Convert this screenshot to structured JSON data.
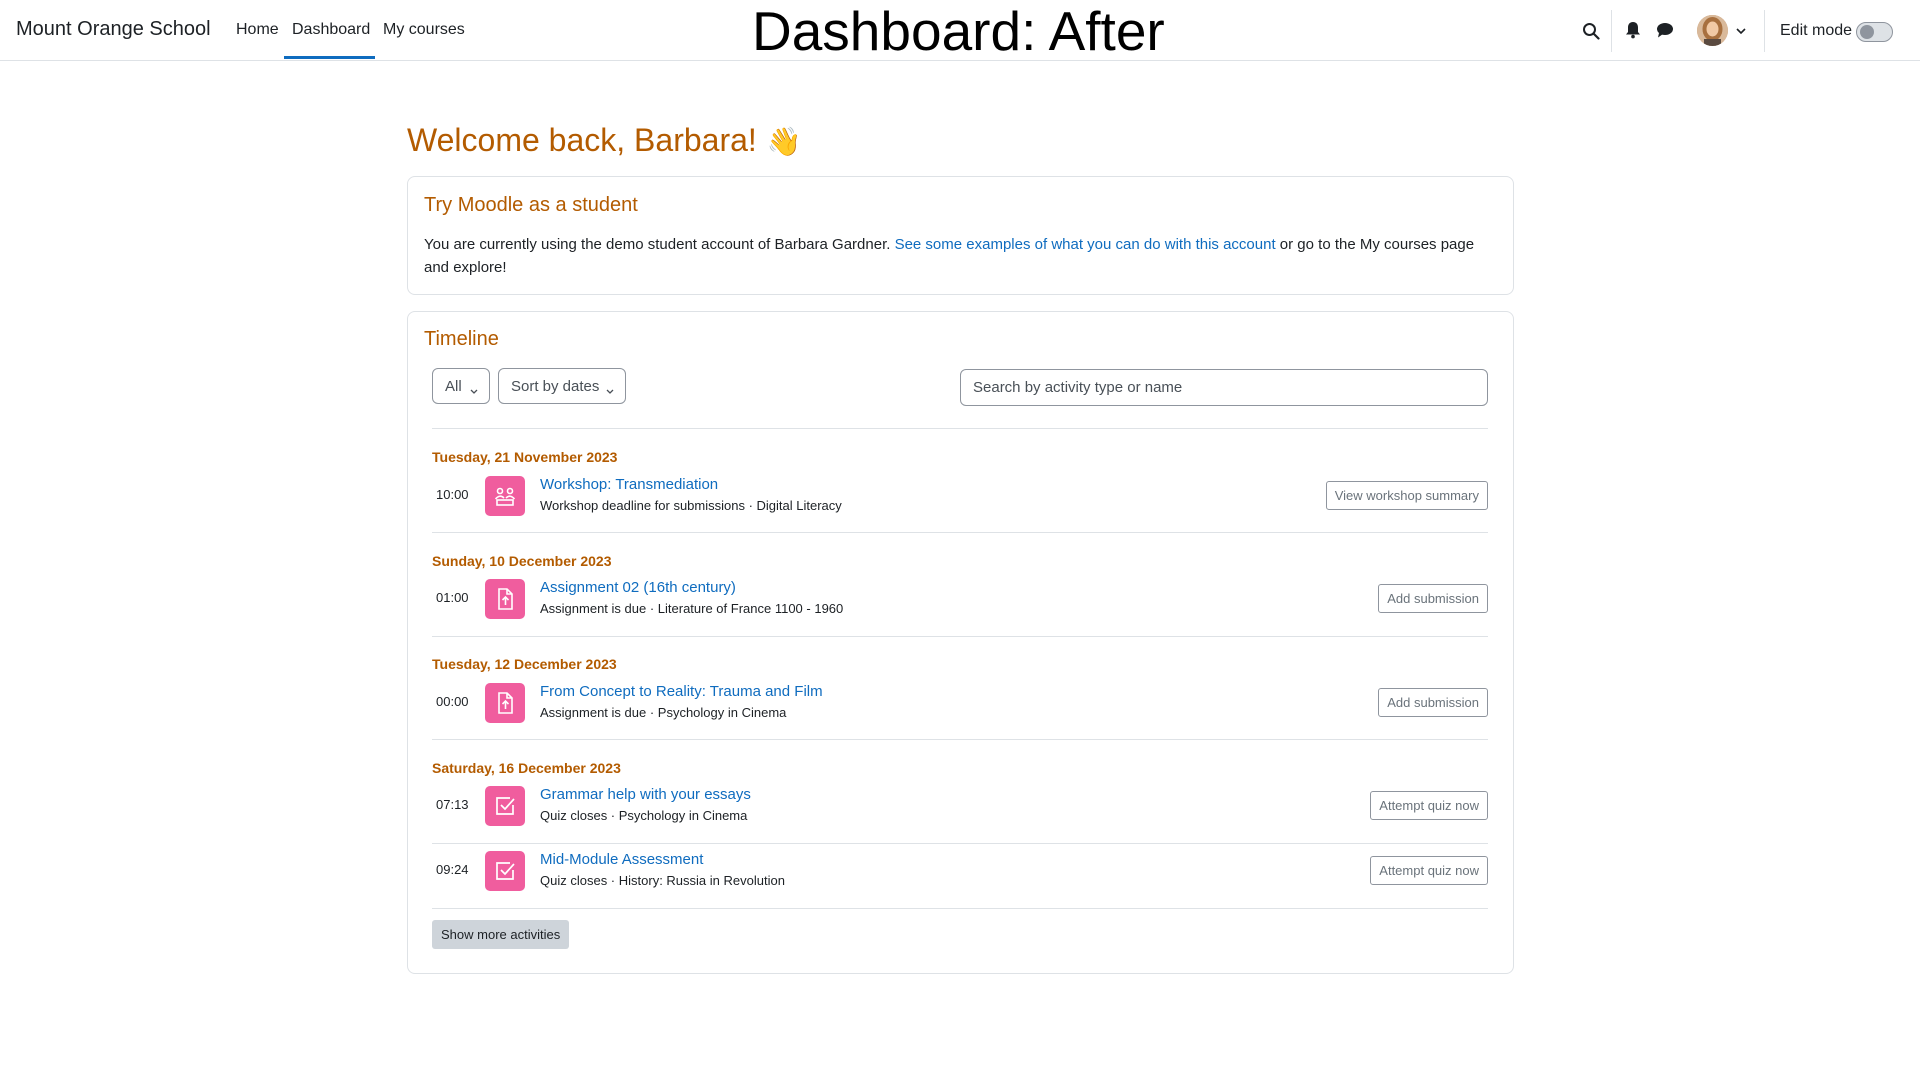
{
  "navbar": {
    "site_name": "Mount Orange School",
    "links": {
      "home": "Home",
      "dashboard": "Dashboard",
      "my_courses": "My courses"
    },
    "active_link": "Dashboard",
    "overlay_title": "Dashboard: After",
    "edit_mode_label": "Edit mode",
    "edit_mode_on": false,
    "icons": [
      "search-icon",
      "bell-icon",
      "chat-icon",
      "avatar",
      "chevron-down-icon"
    ]
  },
  "welcome": {
    "text": "Welcome back, Barbara!",
    "emoji": "👋"
  },
  "try_card": {
    "title": "Try Moodle as a student",
    "text_before": "You are currently using the demo student account of Barbara Gardner. ",
    "link": "See some examples of what you can do with this account",
    "text_after": " or go to the My courses page and explore!"
  },
  "timeline": {
    "title": "Timeline",
    "filter_label": "All",
    "sort_label": "Sort by dates",
    "search_placeholder": "Search by activity type or name",
    "groups": [
      {
        "date": "Tuesday, 21 November 2023",
        "events": [
          {
            "time": "10:00",
            "icon": "workshop-icon",
            "title": "Workshop: Transmediation",
            "subtitle": "Workshop deadline for submissions · Digital Literacy",
            "action": "View workshop summary"
          }
        ]
      },
      {
        "date": "Sunday, 10 December 2023",
        "events": [
          {
            "time": "01:00",
            "icon": "assignment-icon",
            "title": "Assignment 02 (16th century)",
            "subtitle": "Assignment is due · Literature of France 1100 - 1960",
            "action": "Add submission"
          }
        ]
      },
      {
        "date": "Tuesday, 12 December 2023",
        "events": [
          {
            "time": "00:00",
            "icon": "assignment-icon",
            "title": "From Concept to Reality: Trauma and Film",
            "subtitle": "Assignment is due · Psychology in Cinema",
            "action": "Add submission"
          }
        ]
      },
      {
        "date": "Saturday, 16 December 2023",
        "events": [
          {
            "time": "07:13",
            "icon": "quiz-icon",
            "title": "Grammar help with your essays",
            "subtitle": "Quiz closes · Psychology in Cinema",
            "action": "Attempt quiz now"
          },
          {
            "time": "09:24",
            "icon": "quiz-icon",
            "title": "Mid-Module Assessment",
            "subtitle": "Quiz closes · History: Russia in Revolution",
            "action": "Attempt quiz now"
          }
        ]
      }
    ],
    "show_more_label": "Show more activities"
  },
  "colors": {
    "accent": "#b35b00",
    "link": "#0f6cbf",
    "activity_icon_bg": "#f05d9e",
    "border": "#dee2e6"
  }
}
